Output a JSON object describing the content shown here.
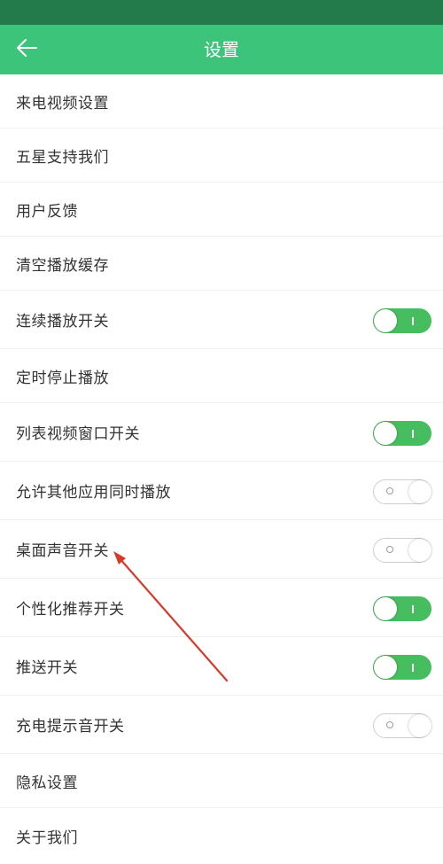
{
  "header": {
    "title": "设置",
    "back_icon": "arrow-left-icon"
  },
  "colors": {
    "status_bar": "#237a4b",
    "app_bar": "#3bc47a",
    "toggle_on": "#46bd5e",
    "annotation_arrow": "#d63a2a"
  },
  "settings": {
    "items": [
      {
        "label": "来电视频设置"
      },
      {
        "label": "五星支持我们"
      },
      {
        "label": "用户反馈"
      },
      {
        "label": "清空播放缓存"
      },
      {
        "label": "连续播放开关",
        "toggle": "on"
      },
      {
        "label": "定时停止播放"
      },
      {
        "label": "列表视频窗口开关",
        "toggle": "on"
      },
      {
        "label": "允许其他应用同时播放",
        "toggle": "off"
      },
      {
        "label": "桌面声音开关",
        "toggle": "off"
      },
      {
        "label": "个性化推荐开关",
        "toggle": "on"
      },
      {
        "label": "推送开关",
        "toggle": "on"
      },
      {
        "label": "充电提示音开关",
        "toggle": "off"
      },
      {
        "label": "隐私设置"
      },
      {
        "label": "关于我们"
      }
    ]
  }
}
